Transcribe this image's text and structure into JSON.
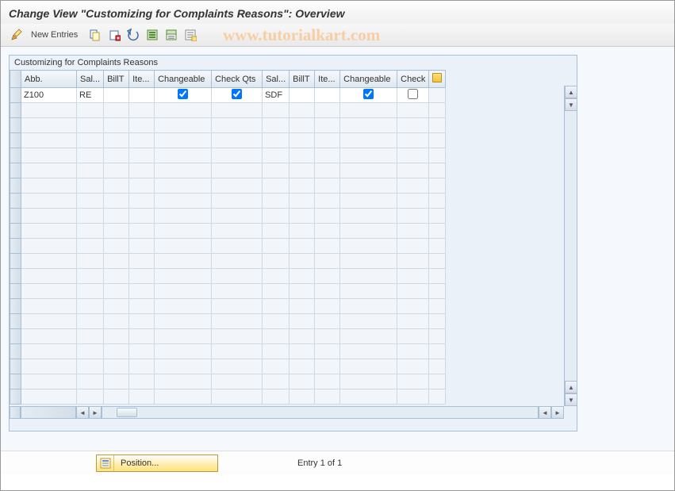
{
  "title": "Change View \"Customizing for Complaints Reasons\": Overview",
  "toolbar": {
    "new_entries_label": "New Entries"
  },
  "watermark": "www.tutorialkart.com",
  "panel": {
    "title": "Customizing for Complaints Reasons"
  },
  "columns": {
    "abb": "Abb.",
    "sal1": "Sal...",
    "billt1": "BillT",
    "ite1": "Ite...",
    "changeable1": "Changeable",
    "checkqts": "Check Qts",
    "sal2": "Sal...",
    "billt2": "BillT",
    "ite2": "Ite...",
    "changeable2": "Changeable",
    "check2": "Check"
  },
  "row1": {
    "abb": "Z100",
    "sal1": "RE",
    "sal2": "SDF"
  },
  "footer": {
    "position_label": "Position...",
    "entry_text": "Entry 1 of 1"
  }
}
